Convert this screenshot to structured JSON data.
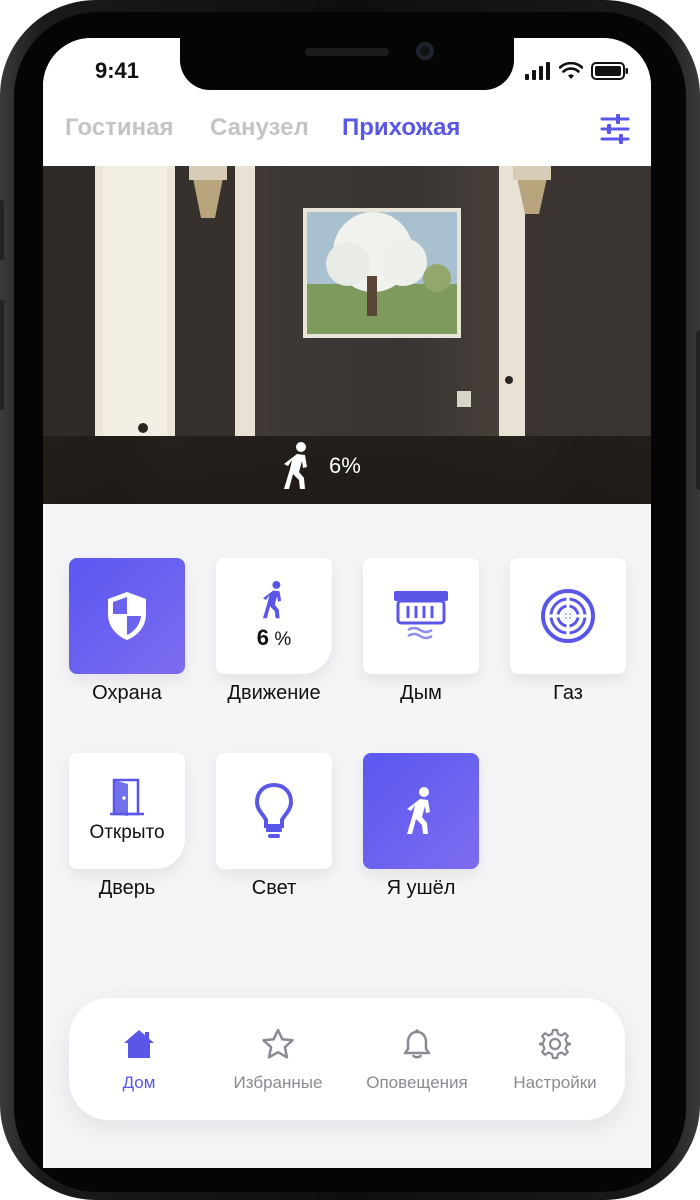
{
  "status_bar": {
    "time": "9:41"
  },
  "rooms": {
    "tabs": [
      {
        "label": "Гостиная",
        "active": false
      },
      {
        "label": "Санузел",
        "active": false
      },
      {
        "label": "Прихожая",
        "active": true
      }
    ],
    "filter_icon": "sliders-icon"
  },
  "camera": {
    "motion_icon": "walking-person-icon",
    "motion_value": "6%"
  },
  "tiles": [
    {
      "label": "Охрана",
      "icon": "shield-icon",
      "active": true
    },
    {
      "label": "Движение",
      "icon": "walking-person-icon",
      "value": "6",
      "unit": "%"
    },
    {
      "label": "Дым",
      "icon": "smoke-detector-icon"
    },
    {
      "label": "Газ",
      "icon": "gas-sensor-icon"
    },
    {
      "label": "Дверь",
      "icon": "door-open-icon",
      "value": "Открыто"
    },
    {
      "label": "Свет",
      "icon": "light-bulb-icon"
    },
    {
      "label": "Я ушёл",
      "icon": "walking-person-icon",
      "active": true
    }
  ],
  "nav": [
    {
      "label": "Дом",
      "icon": "home-icon",
      "active": true
    },
    {
      "label": "Избранные",
      "icon": "star-icon"
    },
    {
      "label": "Оповещения",
      "icon": "bell-icon"
    },
    {
      "label": "Настройки",
      "icon": "gear-icon"
    }
  ],
  "colors": {
    "accent": "#5a57e8",
    "inactive_tab": "#c4c4c8",
    "tile_bg": "#ffffff"
  }
}
